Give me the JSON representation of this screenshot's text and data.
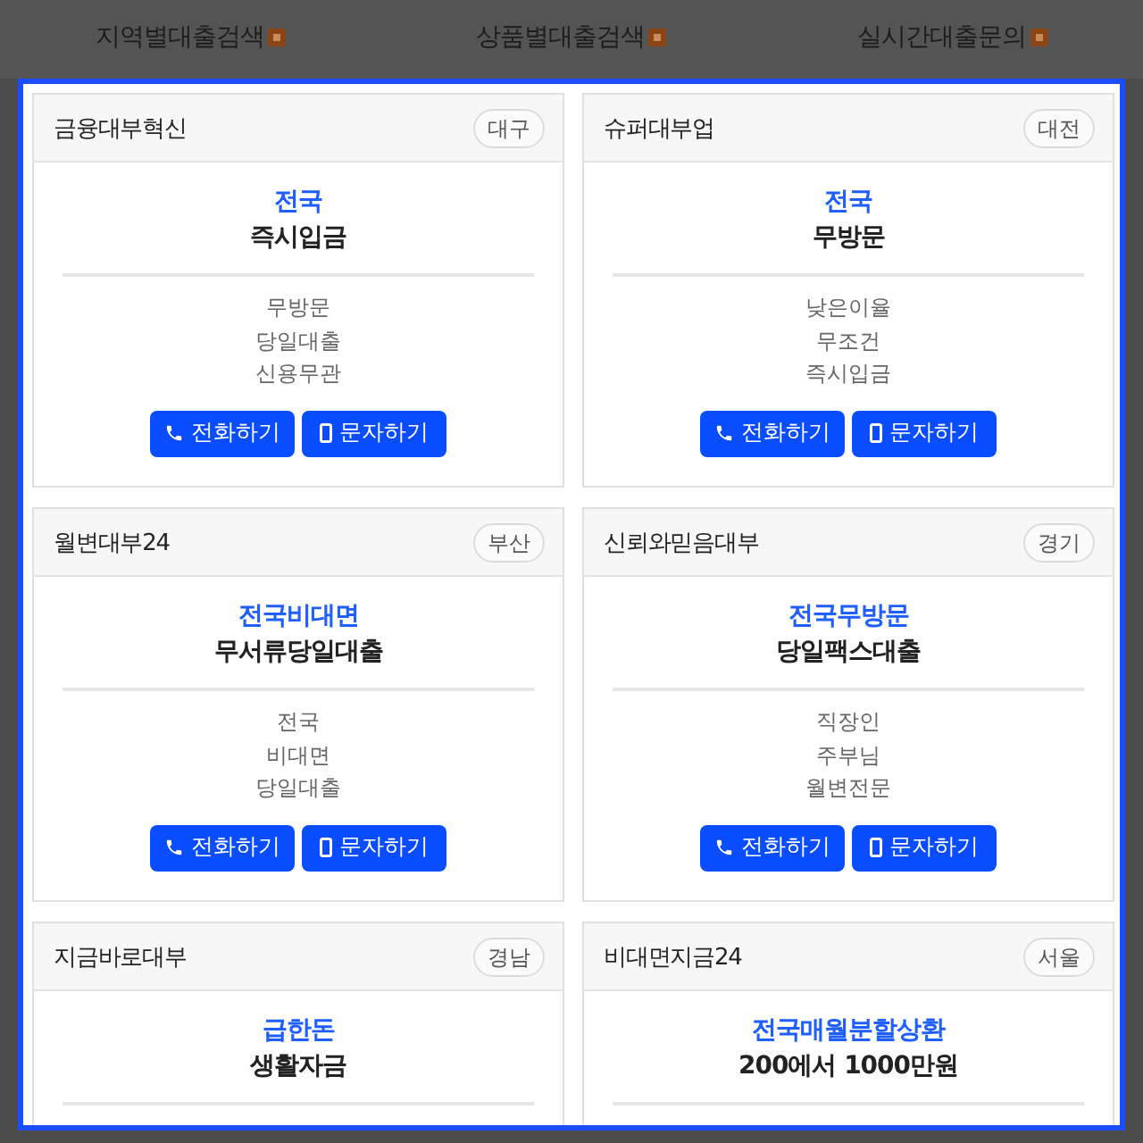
{
  "nav": [
    {
      "label": "지역별대출검색"
    },
    {
      "label": "상품별대출검색"
    },
    {
      "label": "실시간대출문의"
    }
  ],
  "cards": [
    {
      "name": "금융대부혁신",
      "region": "대구",
      "headline": "전국",
      "subheadline": "즉시입금",
      "features": [
        "무방문",
        "당일대출",
        "신용무관"
      ],
      "buttons": [
        {
          "kind": "call",
          "label": "전화하기"
        },
        {
          "kind": "sms",
          "label": "문자하기"
        }
      ]
    },
    {
      "name": "슈퍼대부업",
      "region": "대전",
      "headline": "전국",
      "subheadline": "무방문",
      "features": [
        "낮은이율",
        "무조건",
        "즉시입금"
      ],
      "buttons": [
        {
          "kind": "call",
          "label": "전화하기"
        },
        {
          "kind": "sms",
          "label": "문자하기"
        }
      ]
    },
    {
      "name": "월변대부24",
      "region": "부산",
      "headline": "전국비대면",
      "subheadline": "무서류당일대출",
      "features": [
        "전국",
        "비대면",
        "당일대출"
      ],
      "buttons": [
        {
          "kind": "call",
          "label": "전화하기"
        },
        {
          "kind": "sms",
          "label": "문자하기"
        }
      ]
    },
    {
      "name": "신뢰와믿음대부",
      "region": "경기",
      "headline": "전국무방문",
      "subheadline": "당일팩스대출",
      "features": [
        "직장인",
        "주부님",
        "월변전문"
      ],
      "buttons": [
        {
          "kind": "call",
          "label": "전화하기"
        },
        {
          "kind": "sms",
          "label": "문자하기"
        }
      ]
    },
    {
      "name": "지금바로대부",
      "region": "경남",
      "headline": "급한돈",
      "subheadline": "생활자금"
    },
    {
      "name": "비대면지금24",
      "region": "서울",
      "headline": "전국매월분할상환",
      "subheadline": "200에서 1000만원"
    }
  ]
}
